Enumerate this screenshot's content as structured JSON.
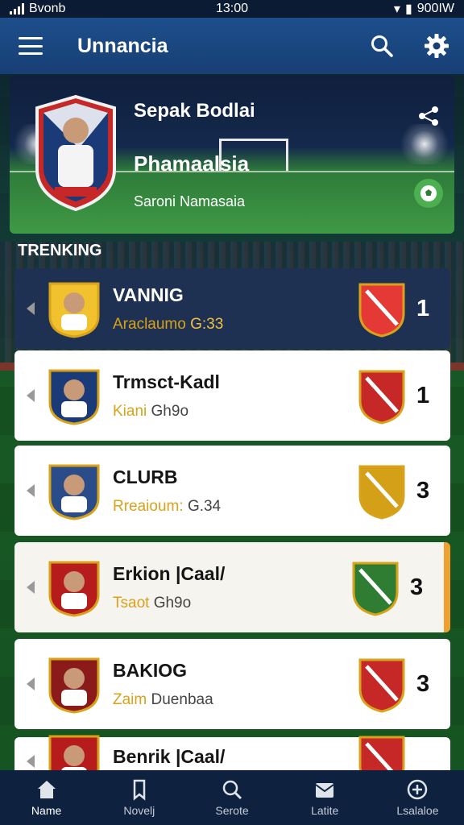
{
  "status_bar": {
    "carrier": "Bvonb",
    "time": "13:00",
    "battery": "900IW"
  },
  "app_bar": {
    "title": "Unnancia",
    "search_icon": "search-icon",
    "settings_icon": "gear-icon"
  },
  "hero": {
    "line1": "Sepak Bodlai",
    "line2": "Phamaalsia",
    "line3": "Saroni Namasaia"
  },
  "section_title": "TRENKING",
  "rows": [
    {
      "name": "VANNIG",
      "sub_a": "Araclaumo",
      "sub_b": "G:33",
      "rank": "1",
      "style": "dark",
      "avatar_color": "#f2c12e",
      "badge": "#e53935"
    },
    {
      "name": "Trmsct-Kadl",
      "sub_a": "Kiani",
      "sub_b": "Gh9o",
      "rank": "1",
      "style": "light",
      "avatar_color": "#1a3a78",
      "badge": "#c62828"
    },
    {
      "name": "CLURB",
      "sub_a": "Rreaioum:",
      "sub_b": "G.34",
      "rank": "3",
      "style": "light",
      "avatar_color": "#2a4d8a",
      "badge": "#d4a017"
    },
    {
      "name": "Erkion |Caal/",
      "sub_a": "Tsaot",
      "sub_b": "Gh9o",
      "rank": "3",
      "style": "accent",
      "avatar_color": "#b71c1c",
      "badge": "#2e7d32"
    },
    {
      "name": "BAKIOG",
      "sub_a": "Zaim",
      "sub_b": "Duenbaa",
      "rank": "3",
      "style": "light",
      "avatar_color": "#8b1a1a",
      "badge": "#c62828"
    },
    {
      "name": "Benrik |Caal/",
      "sub_a": "",
      "sub_b": "",
      "rank": "",
      "style": "light",
      "avatar_color": "#b71c1c",
      "badge": "#c62828"
    }
  ],
  "bottom_nav": [
    {
      "label": "Name",
      "icon": "home-icon"
    },
    {
      "label": "Novelj",
      "icon": "bookmark-icon"
    },
    {
      "label": "Serote",
      "icon": "search-icon"
    },
    {
      "label": "Latite",
      "icon": "inbox-icon"
    },
    {
      "label": "Lsalaloe",
      "icon": "plus-circle-icon"
    }
  ],
  "colors": {
    "app_bar": "#1d4f8c",
    "accent_gold": "#d8a21a",
    "accent_orange": "#f0a030",
    "fab_green": "#4caf50"
  }
}
